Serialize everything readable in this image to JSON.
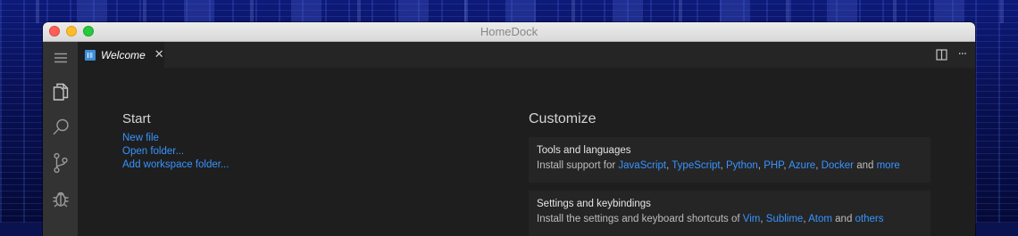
{
  "window": {
    "title": "HomeDock"
  },
  "tab": {
    "label": "Welcome",
    "close_glyph": "✕"
  },
  "editor_actions": {
    "more_glyph": "···"
  },
  "activity_bar": {
    "items": [
      {
        "name": "menu",
        "icon": "hamburger-icon"
      },
      {
        "name": "explorer",
        "icon": "files-icon"
      },
      {
        "name": "search",
        "icon": "search-icon"
      },
      {
        "name": "source-control",
        "icon": "source-control-icon"
      },
      {
        "name": "debug",
        "icon": "bug-icon"
      }
    ]
  },
  "start": {
    "title": "Start",
    "links": [
      "New file",
      "Open folder...",
      "Add workspace folder..."
    ]
  },
  "customize": {
    "title": "Customize",
    "tools": {
      "title": "Tools and languages",
      "prefix": "Install support for ",
      "links": [
        "JavaScript",
        "TypeScript",
        "Python",
        "PHP",
        "Azure",
        "Docker"
      ],
      "sep": ", ",
      "and": " and ",
      "last": "more"
    },
    "settings": {
      "title": "Settings and keybindings",
      "prefix": "Install the settings and keyboard shortcuts of ",
      "links": [
        "Vim",
        "Sublime",
        "Atom"
      ],
      "sep": ", ",
      "and": " and ",
      "last": "others"
    }
  },
  "colors": {
    "link": "#3794ff",
    "editor_bg": "#1e1e1e",
    "activity_bar_bg": "#333333",
    "tab_icon": "#3c8fd8"
  }
}
